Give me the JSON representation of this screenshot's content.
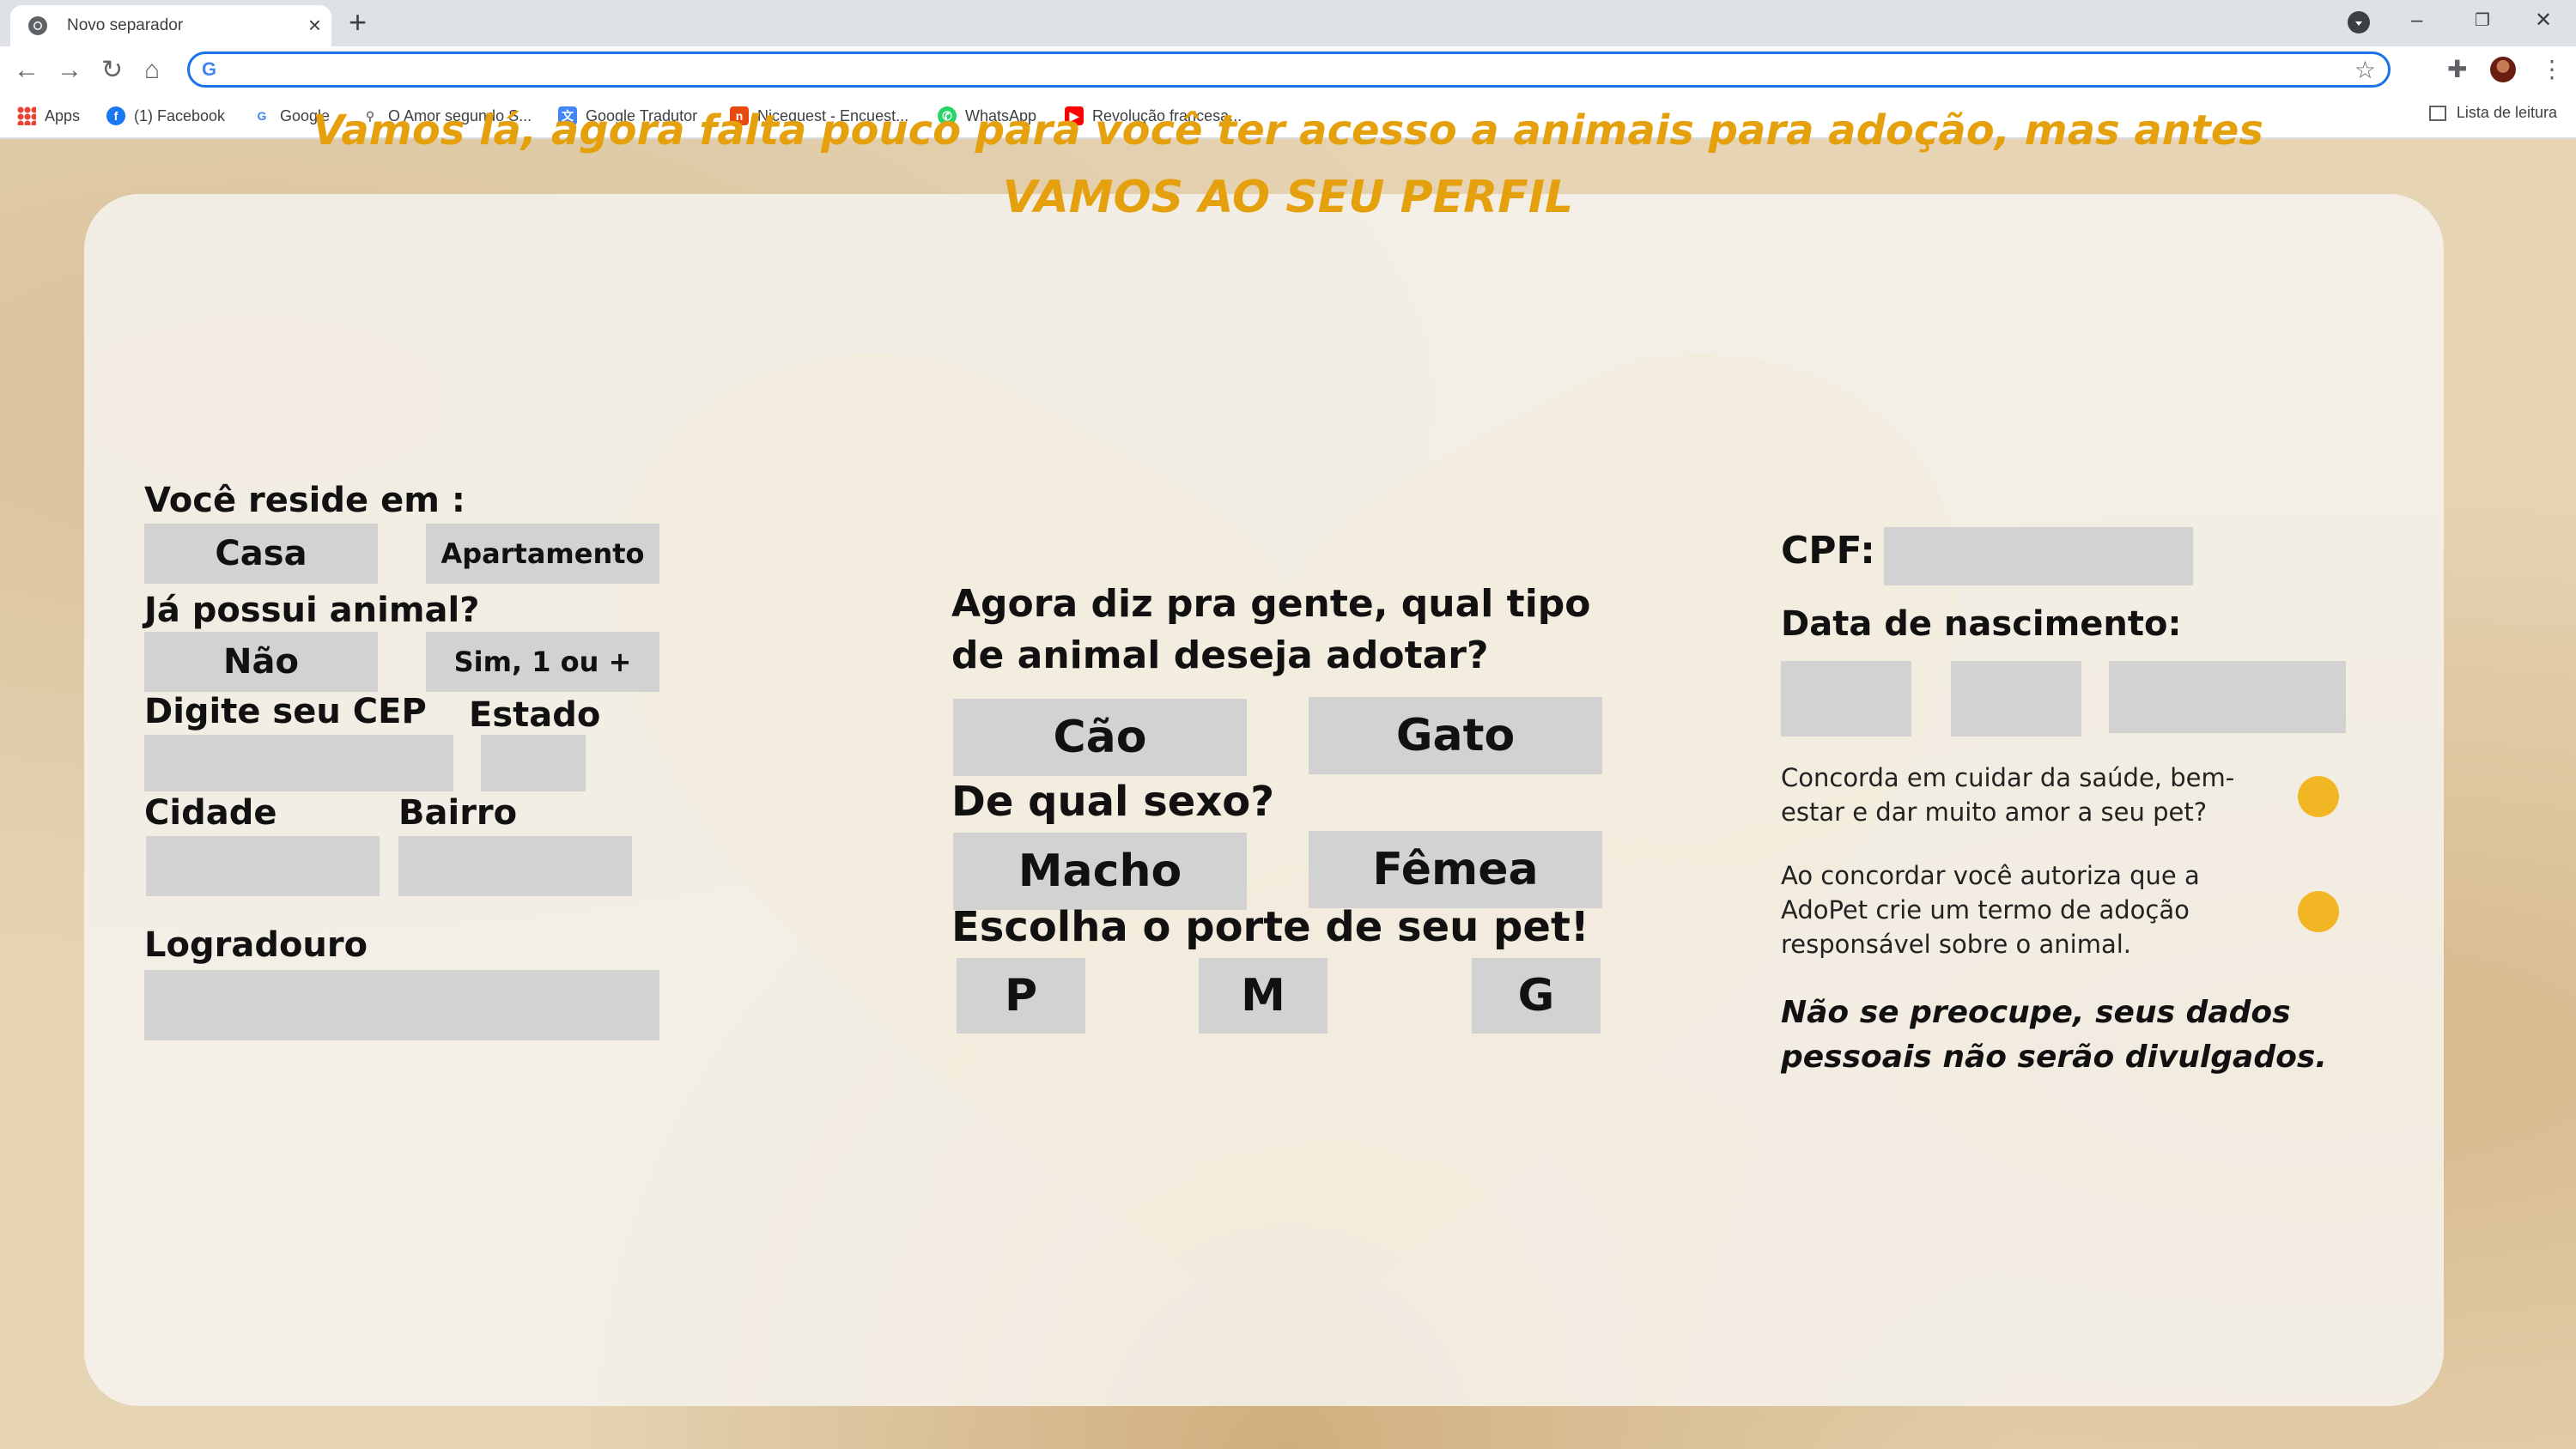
{
  "browser": {
    "tab_title": "Novo separador",
    "omnibox_value": "",
    "bookmarks": [
      {
        "label": "Apps",
        "icon": "apps-icon"
      },
      {
        "label": "(1) Facebook",
        "icon": "facebook-icon",
        "color": "#1877f2"
      },
      {
        "label": "Google",
        "icon": "google-icon",
        "color": "#4285f4"
      },
      {
        "label": "O Amor segundo S...",
        "icon": "bookmark-icon",
        "color": "#777777"
      },
      {
        "label": "Google Tradutor",
        "icon": "translate-icon",
        "color": "#4285f4"
      },
      {
        "label": "Nicequest - Encuest...",
        "icon": "nicequest-icon",
        "color": "#e8490f"
      },
      {
        "label": "WhatsApp",
        "icon": "whatsapp-icon",
        "color": "#25d366"
      },
      {
        "label": "Revolução francesa...",
        "icon": "youtube-icon",
        "color": "#ff0000"
      }
    ],
    "reading_list": "Lista de leitura"
  },
  "header": {
    "line1": "Vamos lá, agora falta pouco para você ter acesso a animais para adoção, mas antes",
    "line2": "VAMOS AO SEU PERFIL",
    "color": "#e5a00d"
  },
  "left": {
    "reside_label": "Você reside em :",
    "casa": "Casa",
    "apartamento": "Apartamento",
    "possui_label": "Já possui animal?",
    "nao": "Não",
    "sim": "Sim, 1 ou +",
    "cep_label": "Digite seu CEP",
    "estado_label": "Estado",
    "cidade_label": "Cidade",
    "bairro_label": "Bairro",
    "logradouro_label": "Logradouro"
  },
  "middle": {
    "tipo_label": "Agora diz pra gente, qual tipo de animal deseja adotar?",
    "cao": "Cão",
    "gato": "Gato",
    "sexo_label": "De qual sexo?",
    "macho": "Macho",
    "femea": "Fêmea",
    "porte_label": "Escolha o porte de seu pet!",
    "p": "P",
    "m": "M",
    "g": "G"
  },
  "right": {
    "cpf_label": "CPF:",
    "nascimento_label": "Data de nascimento:",
    "concorda_text": "Concorda em cuidar da saúde, bem-estar e dar muito amor a seu pet?",
    "autoriza_text": "Ao concordar você autoriza  que  a AdoPet crie um termo de adoção responsável sobre o animal.",
    "note": "Não se preocupe, seus dados pessoais não serão divulgados.",
    "radio_color": "#f2b523"
  },
  "colors": {
    "field_gray": "#d2d2d2",
    "accent": "#e5a00d"
  }
}
